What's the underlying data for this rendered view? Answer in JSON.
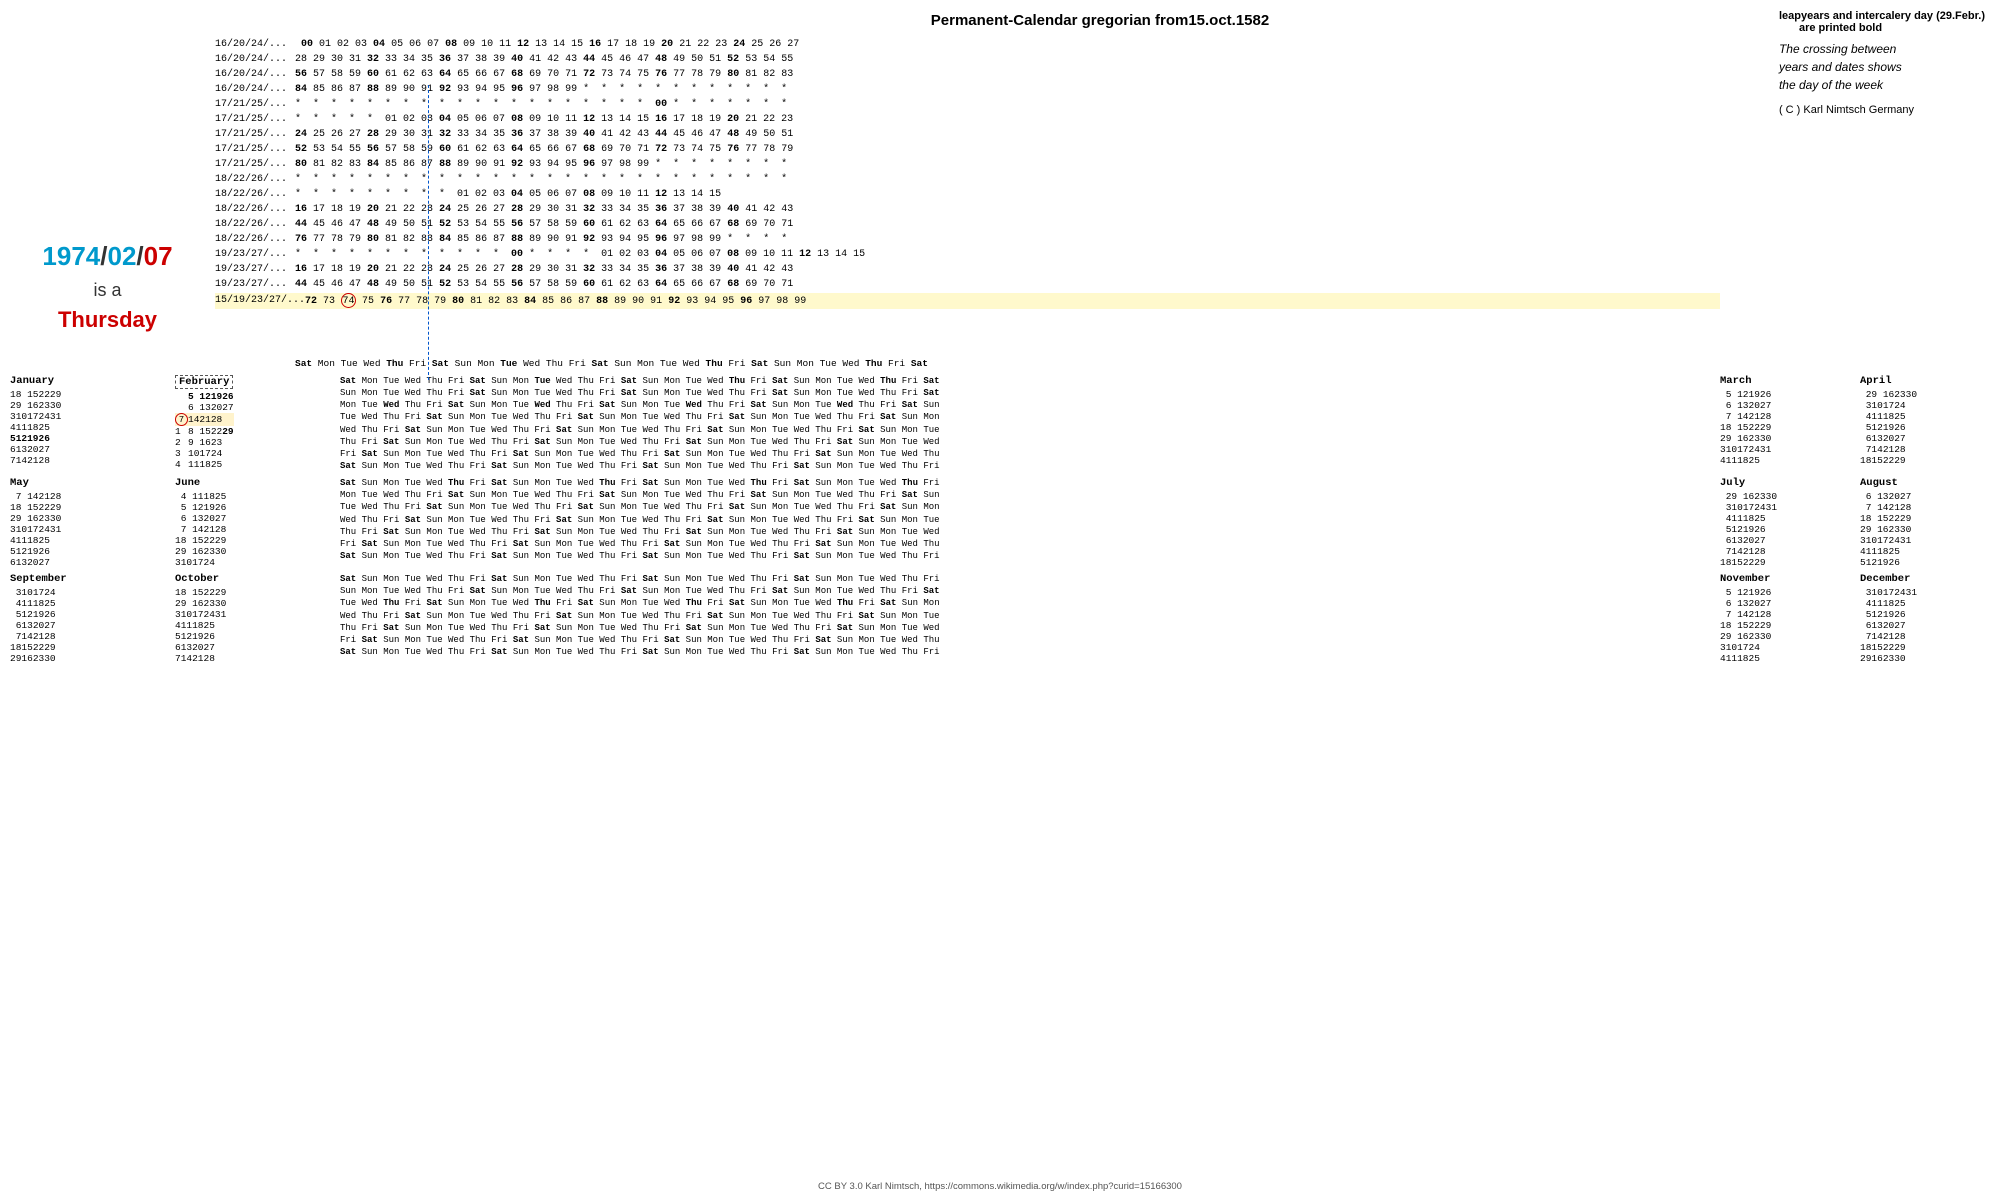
{
  "title": "Permanent-Calendar gregorian from15.oct.1582",
  "top_right": {
    "bold_text": "leapyears and intercalery day (29.Febr.)",
    "bold_text2": "are printed bold",
    "crossing_text": "The crossing between\nyears and dates shows\nthe day of the week",
    "copyright": "( C ) Karl Nimtsch        Germany"
  },
  "date_display": {
    "year": "1974",
    "sep1": "/",
    "month": "02",
    "sep2": "/",
    "day": "07",
    "is_a": "is a",
    "weekday": "Thursday"
  },
  "footer": "CC BY 3.0 Karl Nimtsch, https://commons.wikimedia.org/w/index.php?curid=15166300"
}
